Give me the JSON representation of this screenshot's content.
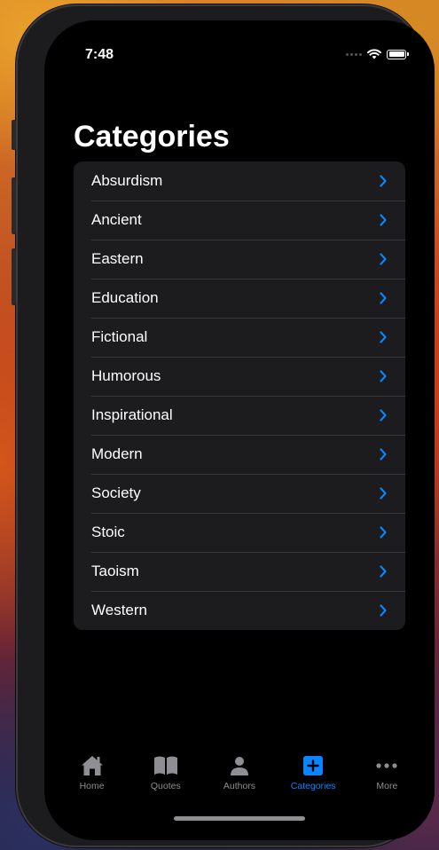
{
  "status": {
    "time": "7:48"
  },
  "page_title": "Categories",
  "categories": [
    {
      "label": "Absurdism"
    },
    {
      "label": "Ancient"
    },
    {
      "label": "Eastern"
    },
    {
      "label": "Education"
    },
    {
      "label": "Fictional"
    },
    {
      "label": "Humorous"
    },
    {
      "label": "Inspirational"
    },
    {
      "label": "Modern"
    },
    {
      "label": "Society"
    },
    {
      "label": "Stoic"
    },
    {
      "label": "Taoism"
    },
    {
      "label": "Western"
    }
  ],
  "tabs": [
    {
      "label": "Home",
      "icon": "house-icon",
      "active": false
    },
    {
      "label": "Quotes",
      "icon": "book-icon",
      "active": false
    },
    {
      "label": "Authors",
      "icon": "person-icon",
      "active": false
    },
    {
      "label": "Categories",
      "icon": "plus-square-icon",
      "active": true
    },
    {
      "label": "More",
      "icon": "ellipsis-icon",
      "active": false
    }
  ],
  "colors": {
    "accent": "#0a84ff",
    "list_background": "#1c1c1e",
    "separator": "#38383a",
    "inactive_tab": "#8e8e93"
  }
}
